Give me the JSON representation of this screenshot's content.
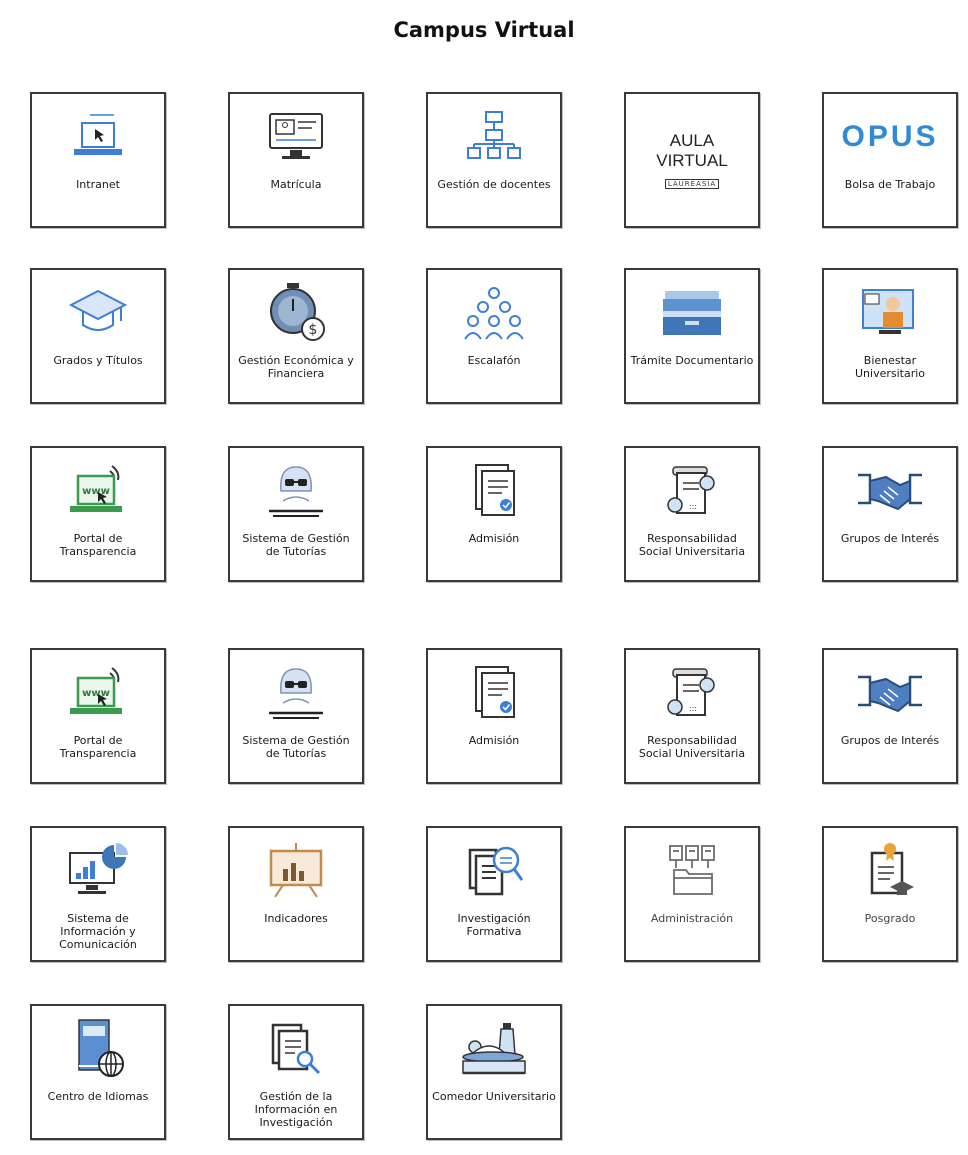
{
  "page": {
    "title": "Campus Virtual"
  },
  "colors": {
    "blue": "#3d7ed6",
    "green": "#3c9a4e",
    "orange": "#c5894b",
    "grey": "#6b6b6b"
  },
  "tiles": [
    {
      "id": "intranet",
      "label": "Intranet",
      "icon": "laptop-cursor-icon"
    },
    {
      "id": "matricula",
      "label": "Matrícula",
      "icon": "monitor-form-icon"
    },
    {
      "id": "gestion-docentes",
      "label": "Gestión de docentes",
      "icon": "org-chart-icon"
    },
    {
      "id": "aula-virtual",
      "label": "",
      "icon": "aula-virtual-logo",
      "logo_lines": [
        "AULA",
        "VIRTUAL",
        "LAUREASIA"
      ]
    },
    {
      "id": "bolsa-trabajo",
      "label": "Bolsa de Trabajo",
      "icon": "opus-logo",
      "logo_text": "OPUS"
    },
    {
      "id": "grados-titulos",
      "label": "Grados y Títulos",
      "icon": "graduation-cap-icon"
    },
    {
      "id": "gestion-economica",
      "label": "Gestión Económica y Financiera",
      "icon": "stopwatch-dollar-icon"
    },
    {
      "id": "escalafon",
      "label": "Escalafón",
      "icon": "people-group-icon"
    },
    {
      "id": "tramite-documentario",
      "label": "Trámite Documentario",
      "icon": "file-drawer-icon"
    },
    {
      "id": "bienestar",
      "label": "Bienestar Universitario",
      "icon": "video-call-icon"
    },
    {
      "id": "portal-transparencia-1",
      "label": "Portal de Transparencia",
      "icon": "laptop-www-icon"
    },
    {
      "id": "tutorias-1",
      "label": "Sistema de Gestión de Tutorías",
      "icon": "tutor-reading-icon"
    },
    {
      "id": "admision-1",
      "label": "Admisión",
      "icon": "document-check-icon"
    },
    {
      "id": "rsu-1",
      "label": "Responsabilidad Social Universitaria",
      "icon": "scroll-people-icon"
    },
    {
      "id": "grupos-interes-1",
      "label": "Grupos de Interés",
      "icon": "handshake-icon"
    },
    {
      "id": "portal-transparencia-2",
      "label": "Portal de Transparencia",
      "icon": "laptop-www-icon"
    },
    {
      "id": "tutorias-2",
      "label": "Sistema de Gestión de Tutorías",
      "icon": "tutor-reading-icon"
    },
    {
      "id": "admision-2",
      "label": "Admisión",
      "icon": "document-check-icon"
    },
    {
      "id": "rsu-2",
      "label": "Responsabilidad Social Universitaria",
      "icon": "scroll-people-icon"
    },
    {
      "id": "grupos-interes-2",
      "label": "Grupos de Interés",
      "icon": "handshake-icon"
    },
    {
      "id": "sic",
      "label": "Sistema de Información y Comunicación",
      "icon": "monitor-chart-icon"
    },
    {
      "id": "indicadores",
      "label": "Indicadores",
      "icon": "board-chart-icon"
    },
    {
      "id": "investigacion-formativa",
      "label": "Investigación Formativa",
      "icon": "document-search-icon"
    },
    {
      "id": "administracion",
      "label": "Administración",
      "icon": "folder-files-icon"
    },
    {
      "id": "posgrado",
      "label": "Posgrado",
      "icon": "certificate-cap-icon"
    },
    {
      "id": "centro-idiomas",
      "label": "Centro de Idiomas",
      "icon": "book-globe-icon"
    },
    {
      "id": "gestion-info-investigacion",
      "label": "Gestión de la Información en Investigación",
      "icon": "document-magnifier-icon"
    },
    {
      "id": "comedor",
      "label": "Comedor Universitario",
      "icon": "food-tray-icon"
    }
  ]
}
